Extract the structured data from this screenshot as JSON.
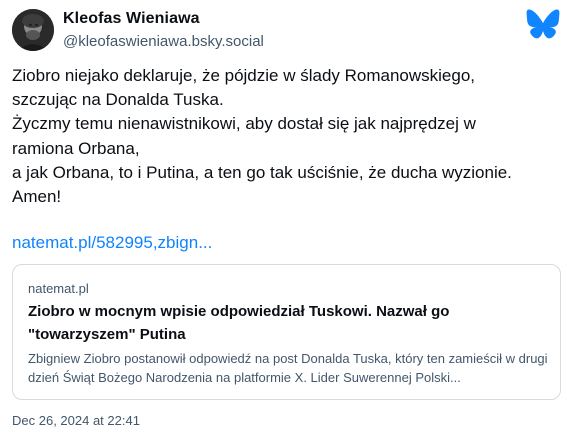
{
  "author": {
    "name": "Kleofas Wieniawa",
    "handle": "@kleofaswieniawa.bsky.social",
    "avatar_icon": "avatar-photo-icon"
  },
  "brand": {
    "icon": "bluesky-butterfly-icon",
    "color": "#1185fe"
  },
  "post": {
    "text": "Ziobro niejako deklaruje, że pójdzie w ślady Romanowskiego,\nszczując na Donalda Tuska.\nŻyczmy temu nienawistnikowi, aby dostał się jak najprędzej w\nramiona Orbana,\na jak Orbana, to i Putina, a ten go tak uściśnie, że ducha wyzionie.\nAmen!",
    "link_text": "natemat.pl/582995,zbign..."
  },
  "embed": {
    "domain": "natemat.pl",
    "title": "Ziobro w mocnym wpisie odpowiedział Tuskowi. Nazwał go \"towarzyszem\" Putina",
    "description": "Zbigniew Ziobro postanowił odpowiedź na post Donalda Tuska, który ten zamieścił w drugi dzień Świąt Bożego Narodzenia na platformie X. Lider Suwerennej Polski..."
  },
  "meta": {
    "timestamp": "Dec 26, 2024 at 22:41"
  },
  "colors": {
    "text": "#0b0f14",
    "muted": "#42576c",
    "link": "#1083fe",
    "border": "#d4dbe2"
  }
}
